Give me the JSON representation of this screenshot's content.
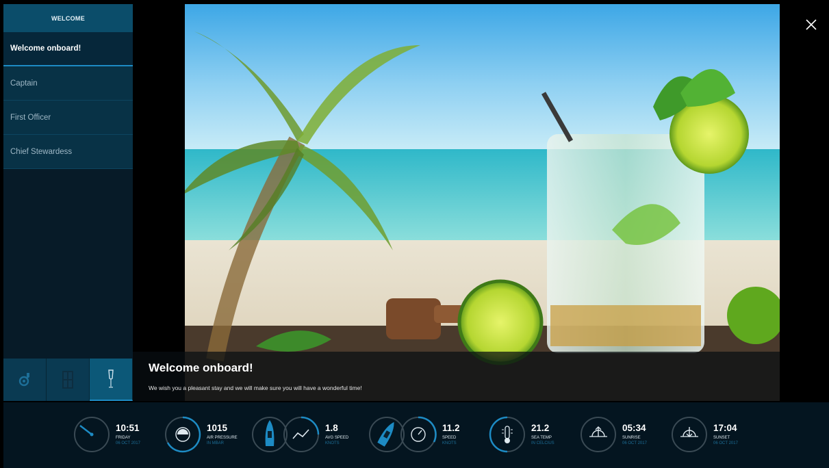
{
  "sidebar": {
    "header": "WELCOME",
    "items": [
      {
        "label": "Welcome onboard!"
      },
      {
        "label": "Captain"
      },
      {
        "label": "First Officer"
      },
      {
        "label": "Chief Stewardess"
      }
    ],
    "tab_icons": [
      "gear-wrench-icon",
      "door-icon",
      "champagne-glass-icon"
    ]
  },
  "hero": {
    "title": "Welcome onboard!",
    "text": "We wish you a pleasant stay and we will make sure you will have a wonderful time!"
  },
  "close_icon": "close-icon",
  "widgets": [
    {
      "value": "10:51",
      "label": "FRIDAY",
      "sub": "06 OCT 2017",
      "icon": "clock-icon"
    },
    {
      "value": "1015",
      "label": "AIR PRESSURE",
      "sub": "IN MBAR",
      "icon": "barometer-icon"
    },
    {
      "value": "1.8",
      "label": "AVG SPEED",
      "sub": "KNOTS",
      "icon": "trend-icon"
    },
    {
      "value": "11.2",
      "label": "SPEED",
      "sub": "KNOTS",
      "icon": "speedometer-icon"
    },
    {
      "value": "21.2",
      "label": "SEA TEMP",
      "sub": "IN CELCIUS",
      "icon": "thermometer-icon"
    },
    {
      "value": "05:34",
      "label": "SUNRISE",
      "sub": "06 OCT 2017",
      "icon": "sunrise-icon"
    },
    {
      "value": "17:04",
      "label": "SUNSET",
      "sub": "06 OCT 2017",
      "icon": "sunset-icon"
    }
  ],
  "colors": {
    "accent": "#1d8bc4",
    "sidebar": "#071b28",
    "bar": "#041520"
  }
}
